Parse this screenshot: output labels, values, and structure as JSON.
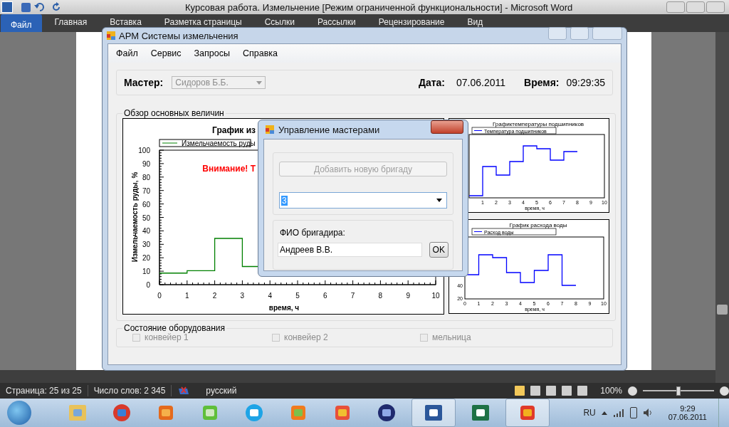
{
  "word": {
    "title": "Курсовая работа. Измельчение [Режим ограниченной функциональности]  -  Microsoft Word",
    "ribbon_tabs": [
      {
        "label": "Файл",
        "selected": true
      },
      {
        "label": "Главная",
        "selected": false
      },
      {
        "label": "Вставка",
        "selected": false
      },
      {
        "label": "Разметка страницы",
        "selected": false
      },
      {
        "label": "Ссылки",
        "selected": false
      },
      {
        "label": "Рассылки",
        "selected": false
      },
      {
        "label": "Рецензирование",
        "selected": false
      },
      {
        "label": "Вид",
        "selected": false
      }
    ]
  },
  "app": {
    "title": "АРМ Системы измельчения",
    "menu": [
      "Файл",
      "Сервис",
      "Запросы",
      "Справка"
    ],
    "master_label": "Мастер:",
    "master": {
      "value": "Сидоров Б.Б.",
      "disabled": true
    },
    "date_label": "Дата:",
    "date": "07.06.2011",
    "time_label": "Время:",
    "time": "09:29:35",
    "overview": {
      "title": "Обзор основных величин",
      "warning": "Внимание! Т",
      "main_chart": {
        "chart_data": {
          "type": "line",
          "title": "График из",
          "xlabel": "время, ч",
          "ylabel": "Измельчаемость руды, %",
          "x": [
            0,
            1,
            1,
            2,
            2,
            3,
            3,
            3.6
          ],
          "series": [
            {
              "name": "Измельчаемость руды",
              "color": "#008000",
              "values": [
                8.6,
                8.6,
                10.4,
                10.4,
                34.4,
                34.4,
                13.5,
                13.5
              ]
            }
          ],
          "xlim": [
            0,
            10
          ],
          "ylim": [
            0,
            100
          ],
          "xticks": [
            0,
            1,
            2,
            3,
            4,
            5,
            6,
            7,
            8,
            9,
            10
          ],
          "yticks": [
            0,
            10,
            20,
            30,
            40,
            50,
            60,
            70,
            80,
            90,
            100
          ]
        }
      },
      "side_charts": [
        {
          "title": "Графиктемпературы подшипников",
          "legend": "Температура подшипников",
          "xlabel": "время, ч",
          "xticks": [
            "1",
            "2",
            "3",
            "4",
            "5",
            "6",
            "7",
            "8",
            "9",
            "10"
          ]
        },
        {
          "title": "График расхода воды",
          "legend": "Расход воды",
          "xlabel": "время, ч",
          "xticks": [
            "0",
            "1",
            "2",
            "3",
            "4",
            "5",
            "6",
            "7",
            "8",
            "9",
            "10"
          ],
          "yticks": [
            "40",
            "20"
          ]
        }
      ]
    },
    "equipment": {
      "title": "Состояние оборудования",
      "items": [
        {
          "label": "конвейер 1",
          "checked": false,
          "disabled": true
        },
        {
          "label": "конвейер 2",
          "checked": false,
          "disabled": true
        },
        {
          "label": "мельница",
          "checked": false,
          "disabled": true
        }
      ]
    }
  },
  "dialog": {
    "title": "Управление мастерами",
    "add_button": {
      "label": "Добавить новую бригаду",
      "disabled": true
    },
    "brigade": {
      "value": "3",
      "selected": true
    },
    "name_label": "ФИО бригадира:",
    "name_value": "Андреев В.В.",
    "ok": "OK"
  },
  "status_bar": {
    "page": "Страница: 25 из 25",
    "words": "Число слов: 2 345",
    "language": "русский",
    "zoom": "100%",
    "zoom_slider": {
      "level": 0.5
    }
  },
  "taskbar": {
    "apps": [
      {
        "kind": "folder",
        "open": false
      },
      {
        "kind": "browser",
        "open": false
      },
      {
        "kind": "player",
        "open": false
      },
      {
        "kind": "gadget",
        "open": false
      },
      {
        "kind": "chat",
        "open": false
      },
      {
        "kind": "map",
        "open": false
      },
      {
        "kind": "tool",
        "open": false
      },
      {
        "kind": "sphere",
        "open": false
      },
      {
        "kind": "word",
        "open": true
      },
      {
        "kind": "excel",
        "open": false
      },
      {
        "kind": "app",
        "open": true
      }
    ],
    "language": "RU",
    "time": "9:29",
    "date": "07.06.2011"
  }
}
